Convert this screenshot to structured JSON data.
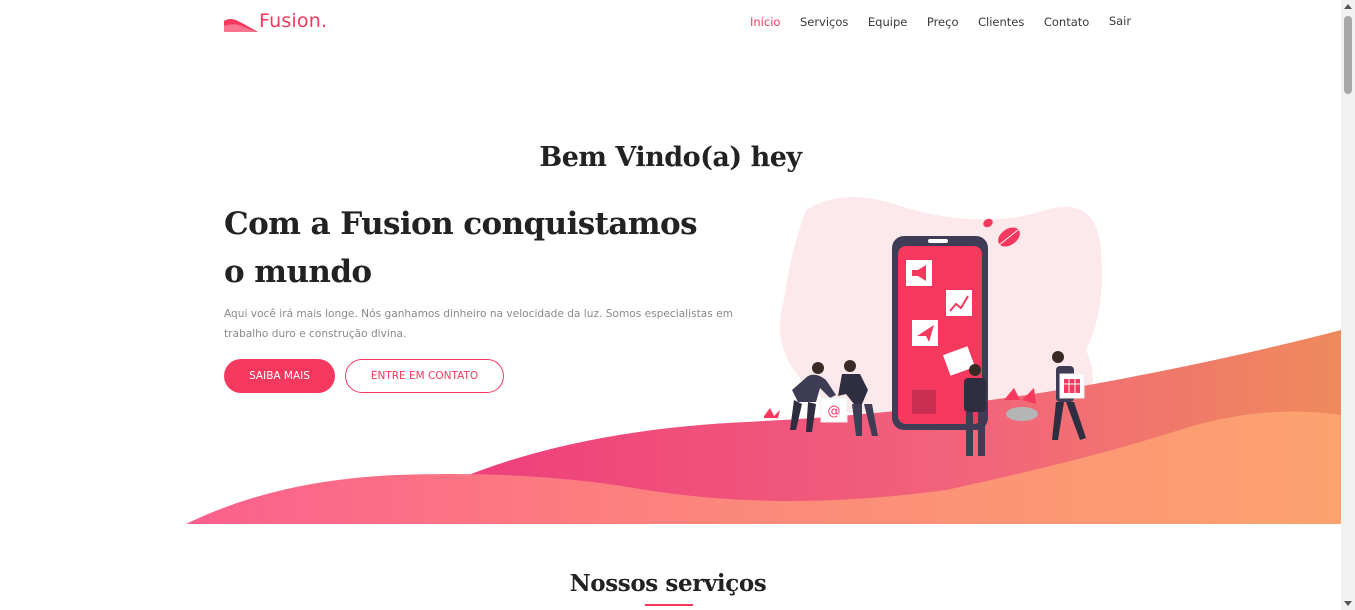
{
  "brand": {
    "name": "Fusion.",
    "accent_color": "#f5395e"
  },
  "nav": {
    "items": [
      {
        "label": "Início",
        "active": true
      },
      {
        "label": "Serviços",
        "active": false
      },
      {
        "label": "Equipe",
        "active": false
      },
      {
        "label": "Preço",
        "active": false
      },
      {
        "label": "Clientes",
        "active": false
      },
      {
        "label": "Contato",
        "active": false
      },
      {
        "label": "Sair",
        "active": false
      }
    ]
  },
  "hero": {
    "welcome": "Bem Vindo(a) hey",
    "title_line1": "Com a Fusion conquistamos",
    "title_line2": "o mundo",
    "description": "Aqui você irá mais longe. Nós ganhamos dinheiro na velocidade da luz. Somos especialistas em trabalho duro e construção divina.",
    "primary_button": "SAIBA MAIS",
    "secondary_button": "ENTRE EM CONTATO",
    "illustration_icons": [
      "megaphone-icon",
      "chart-icon",
      "paper-plane-icon",
      "email-at-icon",
      "calendar-icon",
      "leaf-icon"
    ]
  },
  "services": {
    "title": "Nossos serviços"
  },
  "colors": {
    "gradient_start": "#f84f8a",
    "gradient_end": "#fca26f",
    "dark": "#222222",
    "blob": "#fde8ec"
  }
}
